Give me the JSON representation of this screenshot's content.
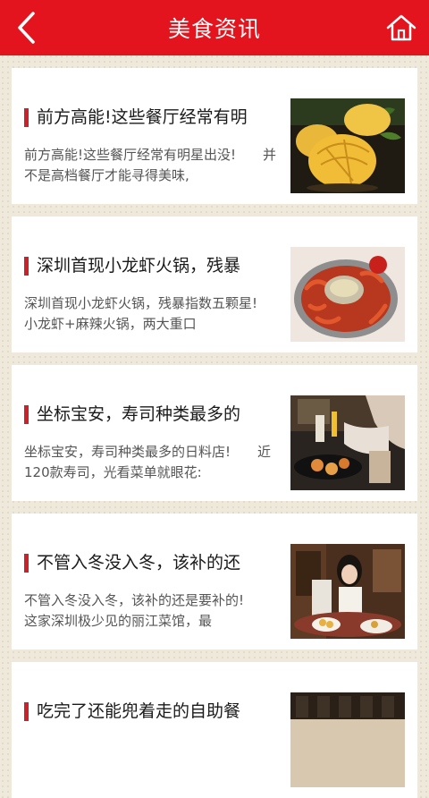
{
  "header": {
    "title": "美食资讯",
    "back_icon": "chevron-left-icon",
    "home_icon": "home-icon"
  },
  "colors": {
    "brand": "#e4141e",
    "accent_bar": "#c8232b"
  },
  "articles": [
    {
      "title": "前方高能!这些餐厅经常有明",
      "summary": "前方高能!这些餐厅经常有明星出没!　　并不是高档餐厅才能寻得美味,",
      "image": "pineapple-bun-photo"
    },
    {
      "title": "深圳首现小龙虾火锅，残暴",
      "summary": "深圳首现小龙虾火锅，残暴指数五颗星!　　小龙虾+麻辣火锅，两大重口",
      "image": "crayfish-hotpot-photo"
    },
    {
      "title": "坐标宝安，寿司种类最多的",
      "summary": "坐标宝安，寿司种类最多的日料店!　　近120款寿司，光看菜单就眼花:",
      "image": "sushi-restaurant-photo"
    },
    {
      "title": "不管入冬没入冬，该补的还",
      "summary": "不管入冬没入冬，该补的还是要补的!　　这家深圳极少见的丽江菜馆，最",
      "image": "lijiang-restaurant-photo"
    },
    {
      "title": "吃完了还能兜着走的自助餐",
      "summary": "",
      "image": "buffet-photo"
    }
  ]
}
